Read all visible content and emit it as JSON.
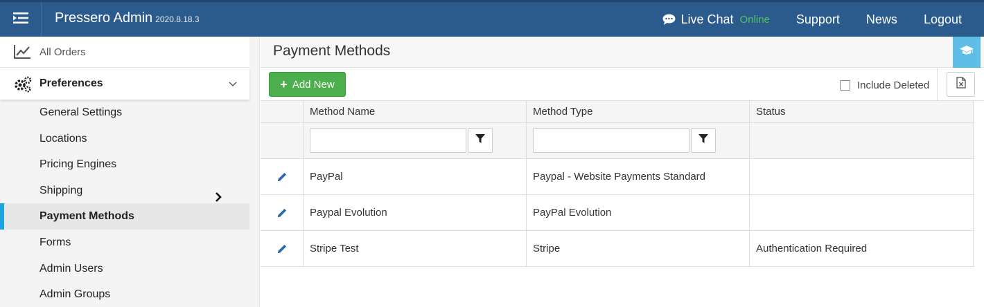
{
  "header": {
    "app_name": "Pressero Admin",
    "version": "2020.8.18.3",
    "live_chat_label": "Live Chat",
    "live_chat_status": "Online",
    "support_label": "Support",
    "news_label": "News",
    "logout_label": "Logout"
  },
  "sidebar": {
    "all_orders_label": "All Orders",
    "preferences_label": "Preferences",
    "items": [
      {
        "label": "General Settings"
      },
      {
        "label": "Locations"
      },
      {
        "label": "Pricing Engines"
      },
      {
        "label": "Shipping"
      },
      {
        "label": "Payment Methods"
      },
      {
        "label": "Forms"
      },
      {
        "label": "Admin Users"
      },
      {
        "label": "Admin Groups"
      }
    ]
  },
  "page": {
    "title": "Payment Methods",
    "add_new_label": "Add New",
    "include_deleted_label": "Include Deleted"
  },
  "table": {
    "columns": [
      "Method Name",
      "Method Type",
      "Status"
    ],
    "rows": [
      {
        "name": "PayPal",
        "type": "Paypal - Website Payments Standard",
        "status": ""
      },
      {
        "name": "Paypal Evolution",
        "type": "PayPal Evolution",
        "status": ""
      },
      {
        "name": "Stripe Test",
        "type": "Stripe",
        "status": "Authentication Required"
      }
    ]
  },
  "colors": {
    "topbar": "#2b5b8c",
    "online": "#4fc35c",
    "add_button": "#4cae4c",
    "active_indicator": "#1ca3e0",
    "help_button": "#5fbde6",
    "error_status": "#c62828"
  }
}
